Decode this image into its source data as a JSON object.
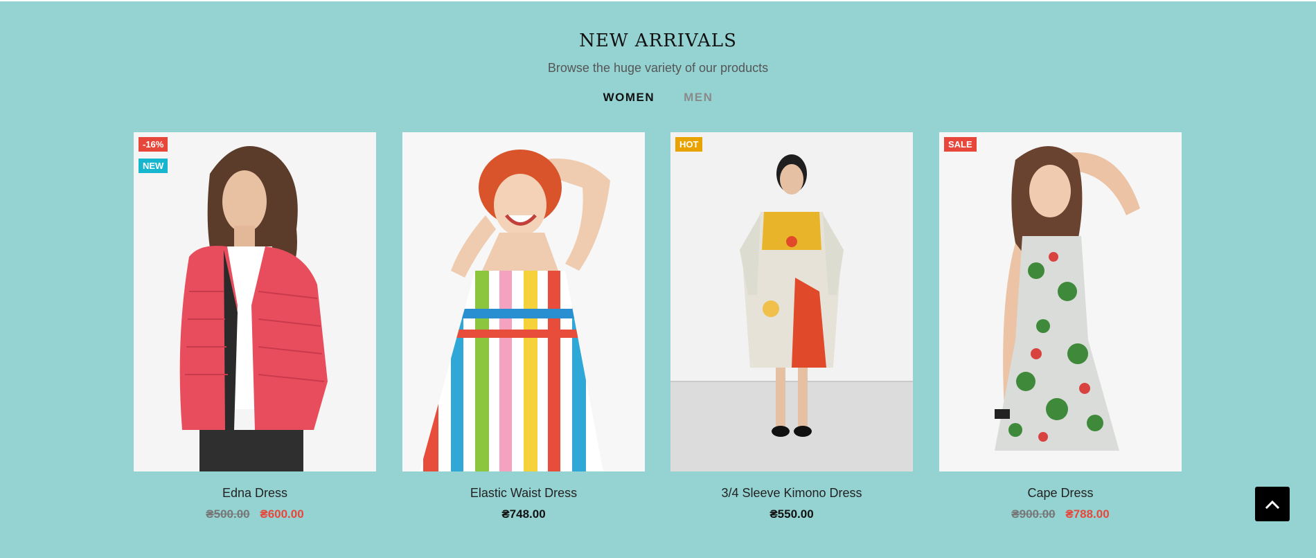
{
  "section": {
    "title": "NEW ARRIVALS",
    "subtitle": "Browse the huge variety of our products"
  },
  "tabs": [
    {
      "label": "WOMEN",
      "active": true
    },
    {
      "label": "MEN",
      "active": false
    }
  ],
  "products": [
    {
      "name": "Edna Dress",
      "badges": [
        "-16%",
        "NEW"
      ],
      "old_price": "₴500.00",
      "price": "₴600.00"
    },
    {
      "name": "Elastic Waist Dress",
      "badges": [],
      "price": "₴748.00"
    },
    {
      "name": "3/4 Sleeve Kimono Dress",
      "badges": [
        "HOT"
      ],
      "price": "₴550.00"
    },
    {
      "name": "Cape Dress",
      "badges": [
        "SALE"
      ],
      "old_price": "₴900.00",
      "price": "₴788.00"
    }
  ],
  "back_to_top": {
    "icon": "chevron-up-icon"
  },
  "colors": {
    "background": "#95d3d3",
    "badge_red": "#e7473b",
    "badge_cyan": "#17b6cf",
    "badge_orange": "#e9a300",
    "sale_price": "#e7473b"
  }
}
